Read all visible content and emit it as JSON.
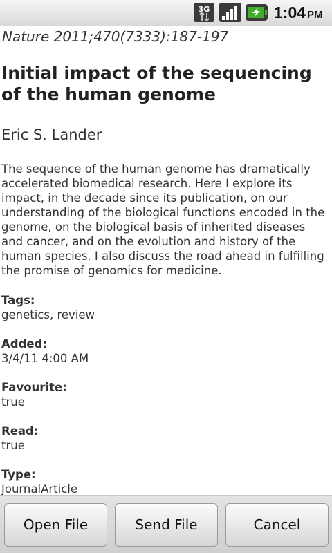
{
  "status_bar": {
    "network_label": "3G",
    "network_icon": "3g-data-icon",
    "signal_icon": "signal-strength-icon",
    "battery_icon": "battery-charging-icon",
    "time": "1:04",
    "ampm": "PM"
  },
  "article": {
    "citation": "Nature 2011;470(7333):187-197",
    "title": "Initial impact of the sequencing of the human genome",
    "author": "Eric S. Lander",
    "abstract": "The sequence of the human genome has dramatically accelerated biomedical research. Here I explore its impact, in the decade since its publication, on our understanding of the biological functions encoded in the genome, on the biological basis of inherited diseases and cancer, and on the evolution and history of the human species. I also discuss the road ahead in fulfilling the promise of genomics for medicine."
  },
  "fields": {
    "tags": {
      "label": "Tags:",
      "value": "genetics, review"
    },
    "added": {
      "label": "Added:",
      "value": "3/4/11 4:00 AM"
    },
    "favourite": {
      "label": "Favourite:",
      "value": "true"
    },
    "read": {
      "label": "Read:",
      "value": "true"
    },
    "type": {
      "label": "Type:",
      "value": "JournalArticle"
    }
  },
  "buttons": {
    "open": "Open File",
    "send": "Send File",
    "cancel": "Cancel"
  },
  "colors": {
    "accent_green": "#3fae29",
    "text": "#333333"
  }
}
